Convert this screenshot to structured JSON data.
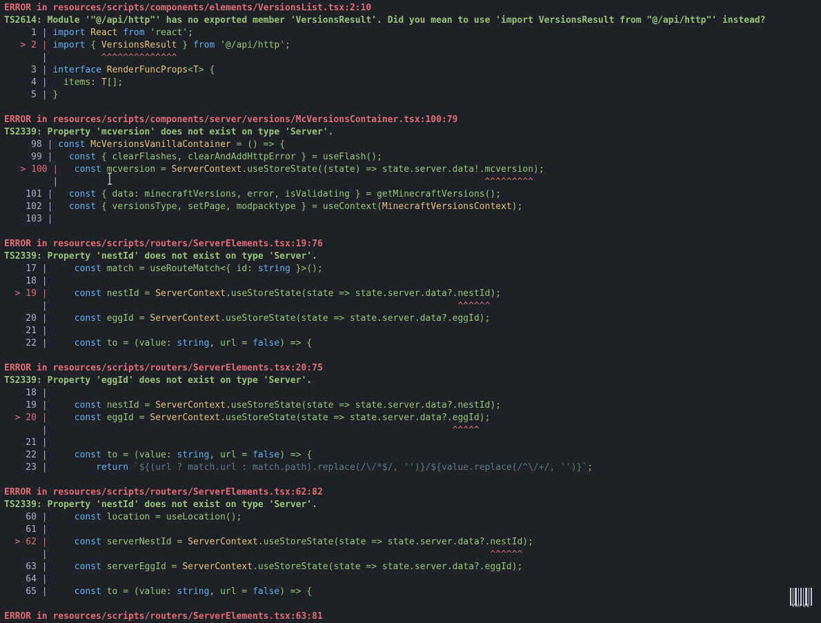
{
  "blocks": [
    {
      "error": "ERROR in resources/scripts/components/elements/VersionsList.tsx:2:10",
      "ts": "TS2614: Module '\"@/api/http\"' has no exported member 'VersionsResult'. Did you mean to use 'import VersionsResult from \"@/api/http\"' instead?",
      "lines": [
        {
          "g": "     1 | ",
          "t": [
            [
              "kw",
              "import"
            ],
            [
              "cd",
              " "
            ],
            [
              "id",
              "React"
            ],
            [
              "cd",
              " "
            ],
            [
              "kw",
              "from"
            ],
            [
              "cd",
              " "
            ],
            [
              "str",
              "'react'"
            ],
            [
              "cd",
              ";"
            ]
          ]
        },
        {
          "g": "   > 2 | ",
          "hl": true,
          "t": [
            [
              "kw",
              "import"
            ],
            [
              "cd",
              " { "
            ],
            [
              "id",
              "VersionsResult"
            ],
            [
              "cd",
              " } "
            ],
            [
              "kw",
              "from"
            ],
            [
              "cd",
              " "
            ],
            [
              "str",
              "'@/api/http'"
            ],
            [
              "cd",
              ";"
            ]
          ]
        },
        {
          "g": "       | ",
          "t": [
            [
              "caret",
              "         ^^^^^^^^^^^^^^"
            ]
          ]
        },
        {
          "g": "     3 | ",
          "t": [
            [
              "kw",
              "interface"
            ],
            [
              "cd",
              " "
            ],
            [
              "id",
              "RenderFuncProps"
            ],
            [
              "cd",
              "<"
            ],
            [
              "id",
              "T"
            ],
            [
              "cd",
              "> {"
            ]
          ]
        },
        {
          "g": "     4 | ",
          "t": [
            [
              "cd",
              "  items: "
            ],
            [
              "id",
              "T"
            ],
            [
              "cd",
              "[];"
            ]
          ]
        },
        {
          "g": "     5 | ",
          "t": [
            [
              "cd",
              "}"
            ]
          ]
        },
        {
          "g": "",
          "t": []
        }
      ]
    },
    {
      "error": "ERROR in resources/scripts/components/server/versions/McVersionsContainer.tsx:100:79",
      "ts": "TS2339: Property 'mcversion' does not exist on type 'Server'.",
      "lines": [
        {
          "g": "     98 | ",
          "t": [
            [
              "kw",
              "const"
            ],
            [
              "cd",
              " "
            ],
            [
              "id",
              "McVersionsVanillaContainer"
            ],
            [
              "cd",
              " = () => {"
            ]
          ]
        },
        {
          "g": "     99 | ",
          "t": [
            [
              "cd",
              "  "
            ],
            [
              "kw",
              "const"
            ],
            [
              "cd",
              " { clearFlashes, clearAndAddHttpError } = useFlash();"
            ]
          ]
        },
        {
          "g": "   > 100 | ",
          "hl": true,
          "t": [
            [
              "cd",
              "  "
            ],
            [
              "kw",
              "const"
            ],
            [
              "cd",
              " mcversion = "
            ],
            [
              "id",
              "ServerContext"
            ],
            [
              "cd",
              ".useStoreState((state) => state.server.data!.mcversion);"
            ]
          ]
        },
        {
          "g": "         | ",
          "t": [
            [
              "caret",
              "                                                                              ^^^^^^^^^"
            ]
          ]
        },
        {
          "g": "    101 | ",
          "t": [
            [
              "cd",
              "  "
            ],
            [
              "kw",
              "const"
            ],
            [
              "cd",
              " { data: minecraftVersions, error, isValidating } = getMinecraftVersions();"
            ]
          ]
        },
        {
          "g": "    102 | ",
          "t": [
            [
              "cd",
              "  "
            ],
            [
              "kw",
              "const"
            ],
            [
              "cd",
              " { versionsType, setPage, modpacktype } = useContext("
            ],
            [
              "id",
              "MinecraftVersionsContext"
            ],
            [
              "cd",
              ");"
            ]
          ]
        },
        {
          "g": "    103 | ",
          "t": []
        },
        {
          "g": "",
          "t": []
        }
      ]
    },
    {
      "error": "ERROR in resources/scripts/routers/ServerElements.tsx:19:76",
      "ts": "TS2339: Property 'nestId' does not exist on type 'Server'.",
      "lines": [
        {
          "g": "    17 | ",
          "t": [
            [
              "cd",
              "    "
            ],
            [
              "kw",
              "const"
            ],
            [
              "cd",
              " match = useRouteMatch<{ id: "
            ],
            [
              "kw",
              "string"
            ],
            [
              "cd",
              " }>();"
            ]
          ]
        },
        {
          "g": "    18 | ",
          "t": []
        },
        {
          "g": "  > 19 | ",
          "hl": true,
          "t": [
            [
              "cd",
              "    "
            ],
            [
              "kw",
              "const"
            ],
            [
              "cd",
              " nestId = "
            ],
            [
              "id",
              "ServerContext"
            ],
            [
              "cd",
              ".useStoreState(state => state.server.data?.nestId);"
            ]
          ]
        },
        {
          "g": "       | ",
          "t": [
            [
              "caret",
              "                                                                           ^^^^^^"
            ]
          ]
        },
        {
          "g": "    20 | ",
          "t": [
            [
              "cd",
              "    "
            ],
            [
              "kw",
              "const"
            ],
            [
              "cd",
              " eggId = "
            ],
            [
              "id",
              "ServerContext"
            ],
            [
              "cd",
              ".useStoreState(state => state.server.data?.eggId);"
            ]
          ]
        },
        {
          "g": "    21 | ",
          "t": []
        },
        {
          "g": "    22 | ",
          "t": [
            [
              "cd",
              "    "
            ],
            [
              "kw",
              "const"
            ],
            [
              "cd",
              " to = (value: "
            ],
            [
              "kw",
              "string"
            ],
            [
              "cd",
              ", url = "
            ],
            [
              "kw",
              "false"
            ],
            [
              "cd",
              ") => {"
            ]
          ]
        },
        {
          "g": "",
          "t": []
        }
      ]
    },
    {
      "error": "ERROR in resources/scripts/routers/ServerElements.tsx:20:75",
      "ts": "TS2339: Property 'eggId' does not exist on type 'Server'.",
      "lines": [
        {
          "g": "    18 | ",
          "t": []
        },
        {
          "g": "    19 | ",
          "t": [
            [
              "cd",
              "    "
            ],
            [
              "kw",
              "const"
            ],
            [
              "cd",
              " nestId = "
            ],
            [
              "id",
              "ServerContext"
            ],
            [
              "cd",
              ".useStoreState(state => state.server.data?.nestId);"
            ]
          ]
        },
        {
          "g": "  > 20 | ",
          "hl": true,
          "t": [
            [
              "cd",
              "    "
            ],
            [
              "kw",
              "const"
            ],
            [
              "cd",
              " eggId = "
            ],
            [
              "id",
              "ServerContext"
            ],
            [
              "cd",
              ".useStoreState(state => state.server.data?.eggId);"
            ]
          ]
        },
        {
          "g": "       | ",
          "t": [
            [
              "caret",
              "                                                                          ^^^^^"
            ]
          ]
        },
        {
          "g": "    21 | ",
          "t": []
        },
        {
          "g": "    22 | ",
          "t": [
            [
              "cd",
              "    "
            ],
            [
              "kw",
              "const"
            ],
            [
              "cd",
              " to = (value: "
            ],
            [
              "kw",
              "string"
            ],
            [
              "cd",
              ", url = "
            ],
            [
              "kw",
              "false"
            ],
            [
              "cd",
              ") => {"
            ]
          ]
        },
        {
          "g": "    23 | ",
          "t": [
            [
              "cd",
              "        "
            ],
            [
              "kw",
              "return"
            ],
            [
              "cd",
              " "
            ],
            [
              "tpl",
              "`${(url ? match.url : match.path).replace(/\\/*$/, '')}/${value.replace(/^\\/+/, '')}`"
            ],
            [
              "cd",
              ";"
            ]
          ]
        },
        {
          "g": "",
          "t": []
        }
      ]
    },
    {
      "error": "ERROR in resources/scripts/routers/ServerElements.tsx:62:82",
      "ts": "TS2339: Property 'nestId' does not exist on type 'Server'.",
      "lines": [
        {
          "g": "    60 | ",
          "t": [
            [
              "cd",
              "    "
            ],
            [
              "kw",
              "const"
            ],
            [
              "cd",
              " location = useLocation();"
            ]
          ]
        },
        {
          "g": "    61 | ",
          "t": []
        },
        {
          "g": "  > 62 | ",
          "hl": true,
          "t": [
            [
              "cd",
              "    "
            ],
            [
              "kw",
              "const"
            ],
            [
              "cd",
              " serverNestId = "
            ],
            [
              "id",
              "ServerContext"
            ],
            [
              "cd",
              ".useStoreState(state => state.server.data?.nestId);"
            ]
          ]
        },
        {
          "g": "       | ",
          "t": [
            [
              "caret",
              "                                                                                 ^^^^^^"
            ]
          ]
        },
        {
          "g": "    63 | ",
          "t": [
            [
              "cd",
              "    "
            ],
            [
              "kw",
              "const"
            ],
            [
              "cd",
              " serverEggId = "
            ],
            [
              "id",
              "ServerContext"
            ],
            [
              "cd",
              ".useStoreState(state => state.server.data?.eggId);"
            ]
          ]
        },
        {
          "g": "    64 | ",
          "t": []
        },
        {
          "g": "    65 | ",
          "t": [
            [
              "cd",
              "    "
            ],
            [
              "kw",
              "const"
            ],
            [
              "cd",
              " to = (value: "
            ],
            [
              "kw",
              "string"
            ],
            [
              "cd",
              ", url = "
            ],
            [
              "kw",
              "false"
            ],
            [
              "cd",
              ") => {"
            ]
          ]
        },
        {
          "g": "",
          "t": []
        }
      ]
    },
    {
      "error": "ERROR in resources/scripts/routers/ServerElements.tsx:63:81",
      "ts": "",
      "lines": []
    }
  ],
  "watermark": {
    "label": "VAPEE",
    "icon": "barcode-icon"
  },
  "colors": {
    "background": "#1e2227",
    "error": "#e06c75",
    "diagnostic": "#98c379",
    "keyword": "#61afef",
    "identifier": "#e5c07b",
    "code": "#98c379"
  }
}
